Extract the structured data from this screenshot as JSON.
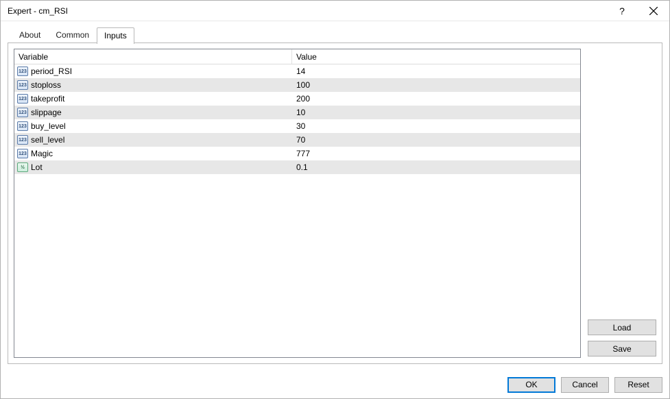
{
  "window": {
    "title": "Expert - cm_RSI"
  },
  "tabs": [
    {
      "label": "About",
      "active": false
    },
    {
      "label": "Common",
      "active": false
    },
    {
      "label": "Inputs",
      "active": true
    }
  ],
  "grid": {
    "headers": {
      "variable": "Variable",
      "value": "Value"
    },
    "rows": [
      {
        "name": "period_RSI",
        "value": "14",
        "type": "int"
      },
      {
        "name": "stoploss",
        "value": "100",
        "type": "int"
      },
      {
        "name": "takeprofit",
        "value": "200",
        "type": "int"
      },
      {
        "name": "slippage",
        "value": "10",
        "type": "int"
      },
      {
        "name": "buy_level",
        "value": "30",
        "type": "int"
      },
      {
        "name": "sell_level",
        "value": "70",
        "type": "int"
      },
      {
        "name": "Magic",
        "value": "777",
        "type": "int"
      },
      {
        "name": "Lot",
        "value": "0.1",
        "type": "double"
      }
    ]
  },
  "side_buttons": {
    "load": "Load",
    "save": "Save"
  },
  "footer_buttons": {
    "ok": "OK",
    "cancel": "Cancel",
    "reset": "Reset"
  },
  "icon_labels": {
    "int": "123",
    "double": "½"
  }
}
